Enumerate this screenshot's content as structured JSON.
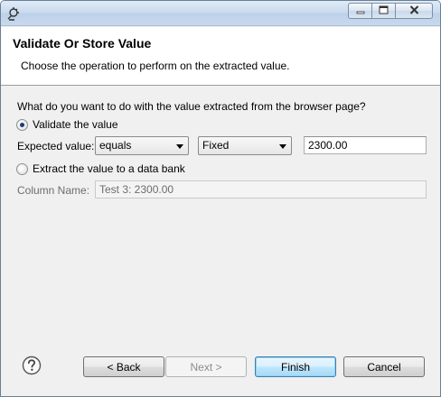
{
  "window": {
    "caption_buttons": {
      "minimize_icon": "minimize-icon",
      "maximize_icon": "maximize-icon",
      "close_icon": "close-icon"
    }
  },
  "header": {
    "title": "Validate Or Store Value",
    "description": "Choose the operation to perform on the extracted value."
  },
  "form": {
    "question": "What do you want to do with the value extracted from the browser page?",
    "validate_option": {
      "label": "Validate the value",
      "checked": true
    },
    "expected_label": "Expected value:",
    "operator_select": {
      "value": "equals"
    },
    "type_select": {
      "value": "Fixed"
    },
    "expected_input": {
      "value": "2300.00"
    },
    "extract_option": {
      "label": "Extract the value to a data bank",
      "checked": false
    },
    "column_label": "Column Name:",
    "column_input": {
      "value": "Test 3: 2300.00"
    }
  },
  "footer": {
    "help_icon": "help-icon",
    "back_label": "< Back",
    "next_label": "Next >",
    "finish_label": "Finish",
    "cancel_label": "Cancel"
  },
  "colors": {
    "banner_bg": "#ffffff",
    "dialog_bg": "#f0f0f0",
    "default_button": "#bee6fd"
  }
}
